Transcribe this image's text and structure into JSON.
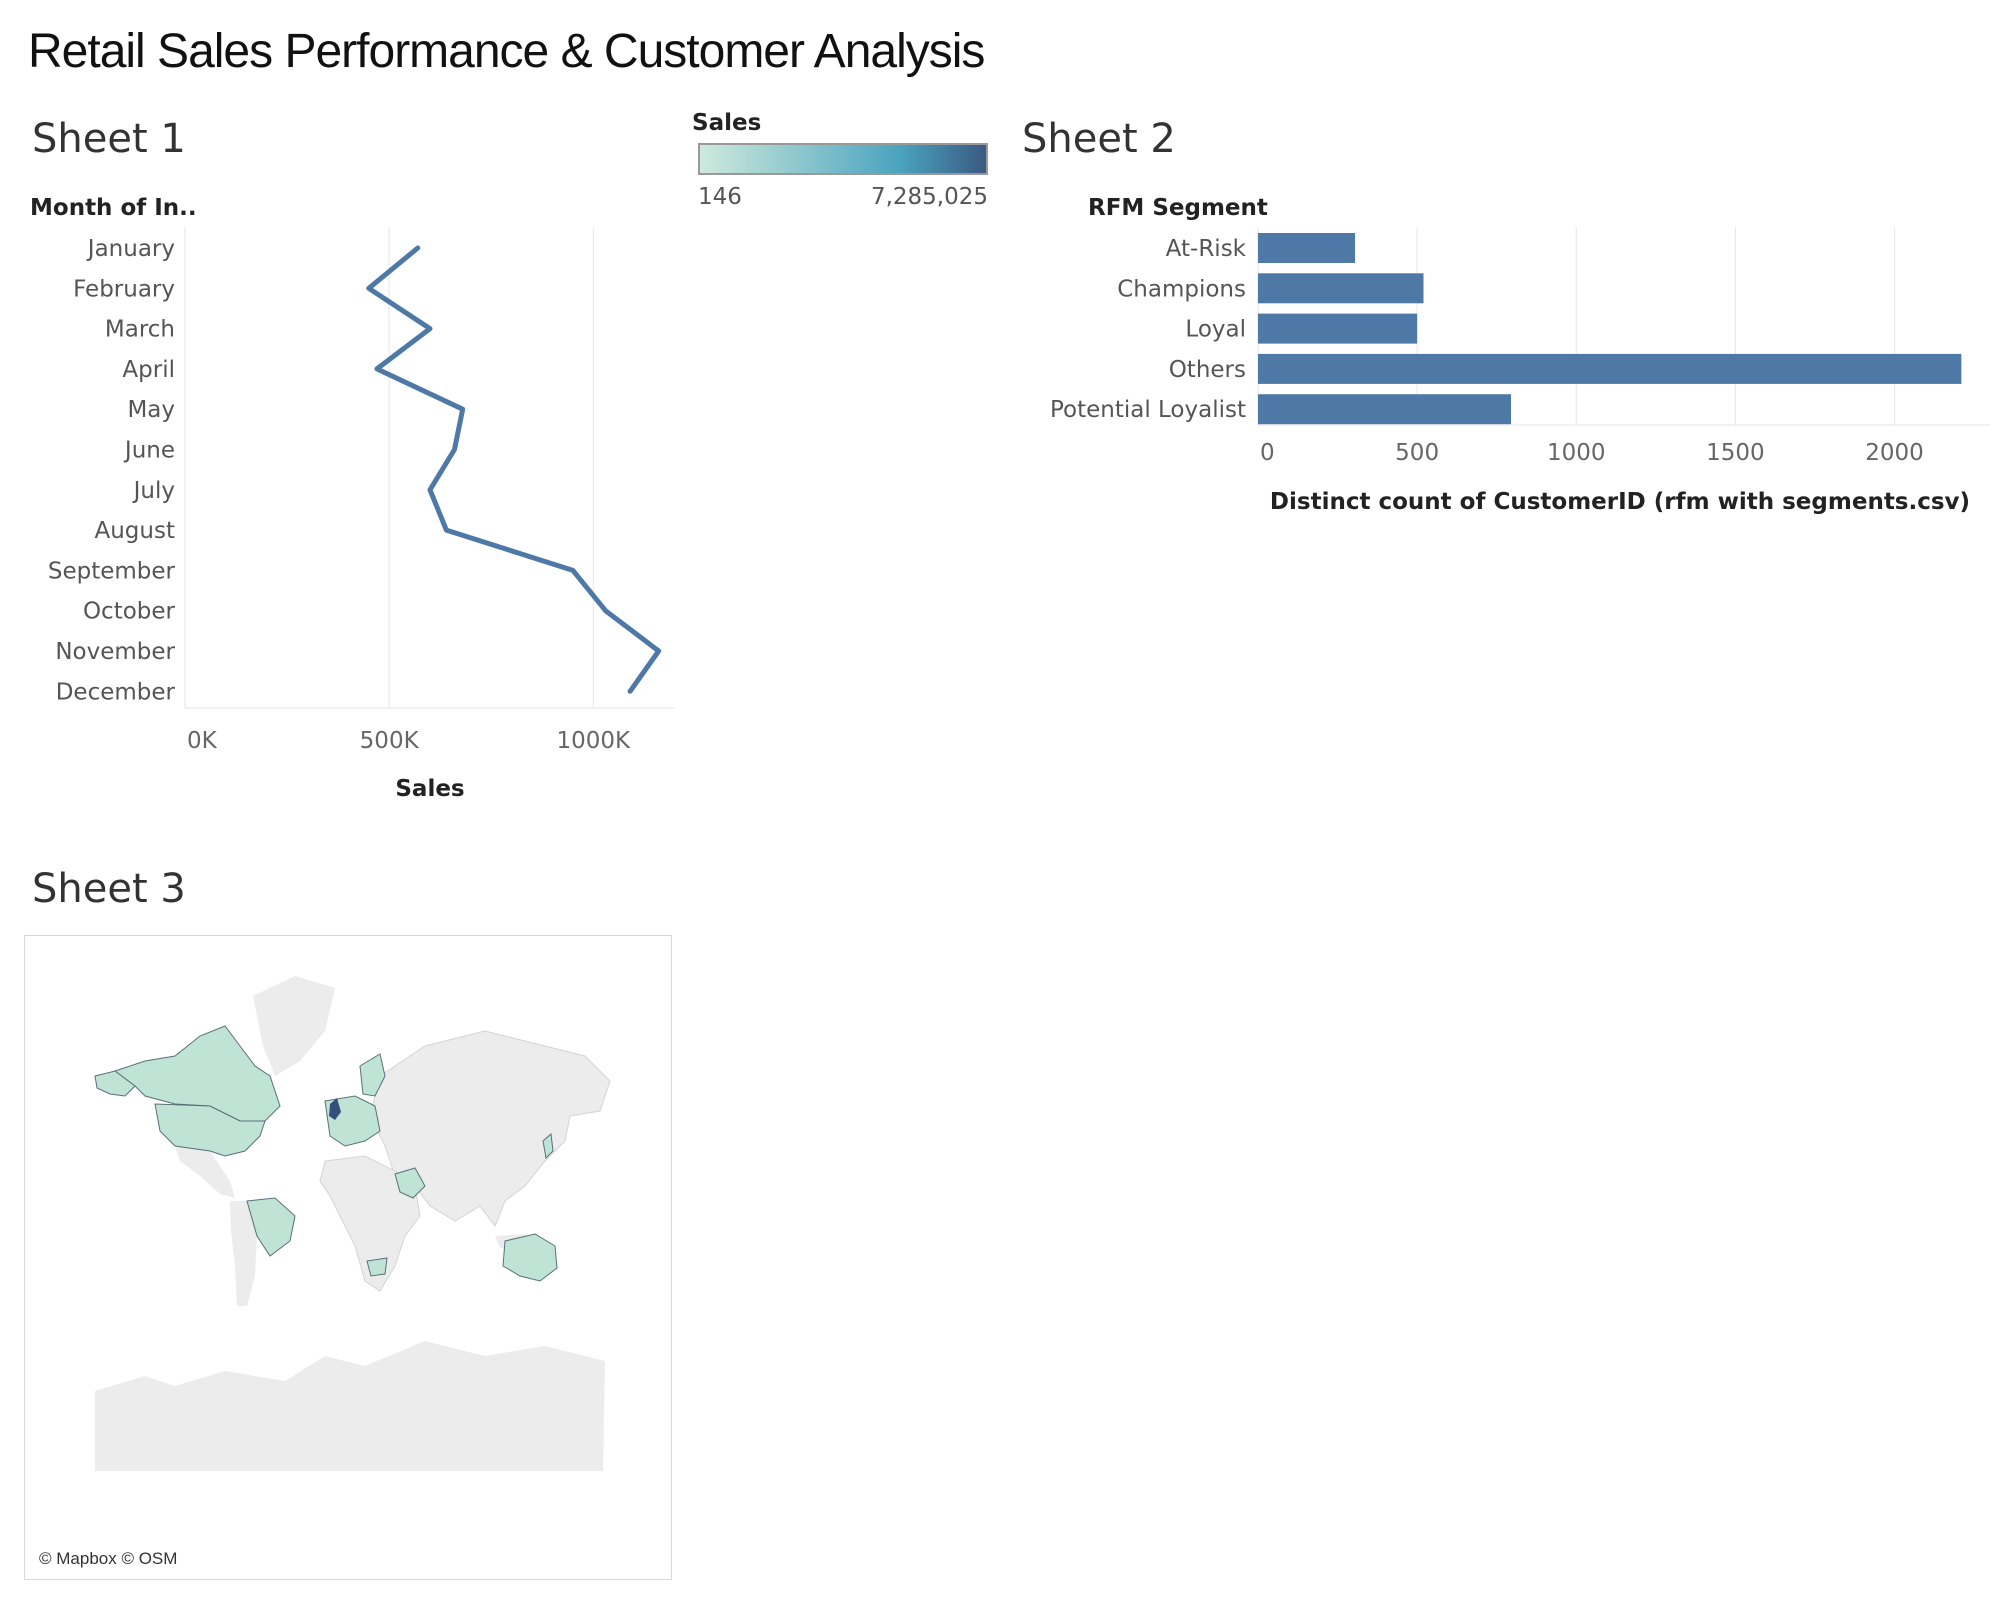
{
  "dashboard": {
    "title": "Retail Sales Performance & Customer Analysis"
  },
  "sheet1": {
    "title": "Sheet 1"
  },
  "sheet2": {
    "title": "Sheet 2"
  },
  "sheet3": {
    "title": "Sheet 3",
    "credit": "© Mapbox © OSM"
  },
  "legend": {
    "title": "Sales",
    "min_label": "146",
    "max_label": "7,285,025",
    "color_low": "#cfe9dc",
    "color_mid": "#4aa3bf",
    "color_high": "#3a5a82"
  },
  "colors": {
    "mark": "#4e79a7",
    "map_no_data": "#ececec",
    "map_low": "#bfe4d6",
    "map_high": "#34507a",
    "gridline": "#e6e6e6"
  },
  "chart_data": [
    {
      "type": "line",
      "orientation": "vertical-categories",
      "column_header": "Month of In..",
      "xlabel": "Sales",
      "categories": [
        "January",
        "February",
        "March",
        "April",
        "May",
        "June",
        "July",
        "August",
        "September",
        "October",
        "November",
        "December"
      ],
      "values": [
        570000,
        450000,
        600000,
        470000,
        680000,
        660000,
        600000,
        640000,
        950000,
        1030000,
        1160000,
        1090000
      ],
      "xlim": [
        0,
        1200000
      ],
      "ticks": [
        "0K",
        "500K",
        "1000K"
      ],
      "tick_values": [
        0,
        500000,
        1000000
      ],
      "grid": true
    },
    {
      "type": "bar",
      "orientation": "horizontal",
      "column_header": "RFM Segment",
      "xlabel": "Distinct count of CustomerID (rfm with segments.csv)",
      "categories": [
        "At-Risk",
        "Champions",
        "Loyal",
        "Others",
        "Potential Loyalist"
      ],
      "values": [
        305,
        520,
        500,
        2210,
        795
      ],
      "xlim": [
        0,
        2300
      ],
      "ticks": [
        "0",
        "500",
        "1000",
        "1500",
        "2000"
      ],
      "tick_values": [
        0,
        500,
        1000,
        1500,
        2000
      ],
      "grid": true
    },
    {
      "type": "map",
      "measure": "Sales"
    }
  ]
}
